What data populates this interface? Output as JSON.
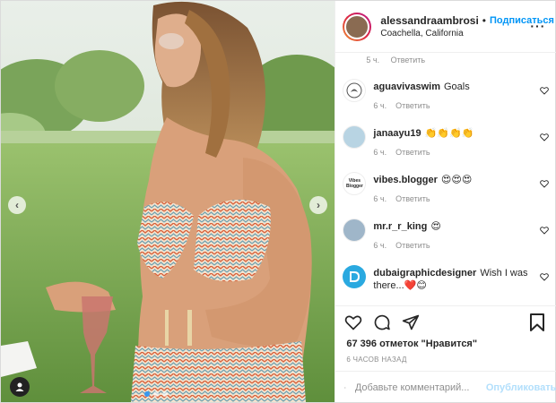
{
  "header": {
    "username": "alessandraambrosi",
    "separator": "•",
    "follow_label": "Подписаться",
    "location": "Coachella, California",
    "more_icon": "more-horizontal-icon"
  },
  "comments_top_meta": {
    "time": "5 ч.",
    "reply": "Ответить"
  },
  "comments": [
    {
      "user": "aguavivaswim",
      "text": "Goals",
      "time": "6 ч.",
      "reply": "Ответить"
    },
    {
      "user": "janaayu19",
      "text": "👏👏👏👏",
      "time": "6 ч.",
      "reply": "Ответить"
    },
    {
      "user": "vibes.blogger",
      "text": "😍😍😍",
      "time": "6 ч.",
      "reply": "Ответить",
      "avatar_text": "Vibes Blogger"
    },
    {
      "user": "mr.r_r_king",
      "text": "😍",
      "time": "6 ч.",
      "reply": "Ответить"
    },
    {
      "user": "dubaigraphicdesigner",
      "text": "Wish I was there...❤️😊",
      "time": "",
      "reply": ""
    }
  ],
  "actions": {
    "likes": "67 396 отметок \"Нравится\"",
    "time_ago": "6 ЧАСОВ НАЗАД",
    "comment_placeholder": "Добавьте комментарий...",
    "publish_label": "Опубликовать"
  },
  "colors": {
    "accent": "#0095f6",
    "text": "#262626",
    "muted": "#8e8e8e"
  },
  "carousel": {
    "current_slide": 1,
    "total_slides": 3
  }
}
